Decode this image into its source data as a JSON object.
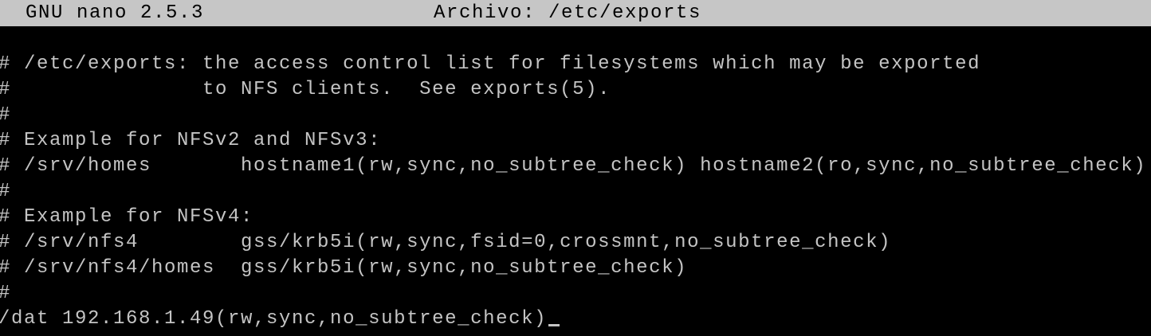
{
  "titlebar": {
    "app": "GNU nano 2.5.3",
    "file": "Archivo: /etc/exports"
  },
  "colors": {
    "background": "#000000",
    "text": "#c4c4c4",
    "titlebar": "#c6c6c6"
  },
  "lines": [
    "",
    "# /etc/exports: the access control list for filesystems which may be exported",
    "#               to NFS clients.  See exports(5).",
    "#",
    "# Example for NFSv2 and NFSv3:",
    "# /srv/homes       hostname1(rw,sync,no_subtree_check) hostname2(ro,sync,no_subtree_check)",
    "#",
    "# Example for NFSv4:",
    "# /srv/nfs4        gss/krb5i(rw,sync,fsid=0,crossmnt,no_subtree_check)",
    "# /srv/nfs4/homes  gss/krb5i(rw,sync,no_subtree_check)",
    "#",
    "/dat 192.168.1.49(rw,sync,no_subtree_check)"
  ]
}
